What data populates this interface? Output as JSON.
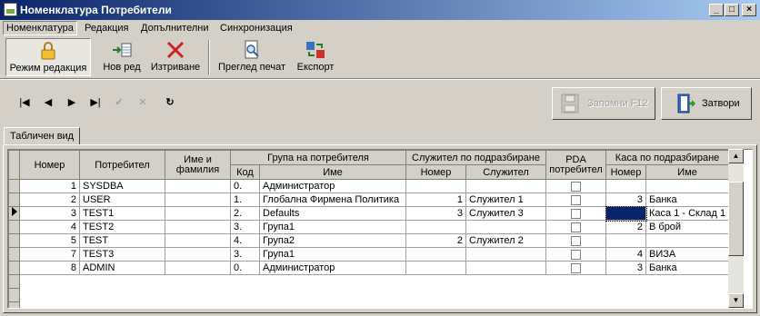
{
  "window": {
    "title": "Номенклатура Потребители"
  },
  "menu": [
    "Номенклатура",
    "Редакция",
    "Допълнителни",
    "Синхронизация"
  ],
  "toolbar": {
    "edit_mode": "Режим редакция",
    "new_row": "Нов ред",
    "delete": "Изтриване",
    "print_preview": "Преглед печат",
    "export": "Експорт"
  },
  "nav": {
    "first": "|◀",
    "prev": "◀",
    "next": "▶",
    "last": "▶|",
    "post": "✔",
    "cancel": "✕",
    "refresh": "↻",
    "save_label": "Запомни  F12",
    "close_label": "Затвори"
  },
  "tab": "Табличен вид",
  "grid": {
    "headers": {
      "number": "Номер",
      "user": "Потребител",
      "fullname": "Име и фамилия",
      "group": "Група на потребителя",
      "group_code": "Код",
      "group_name": "Име",
      "employee": "Служител по подразбиране",
      "emp_number": "Номер",
      "emp_name": "Служител",
      "pda": "PDA потребител",
      "cash": "Каса по подразбиране",
      "cash_number": "Номер",
      "cash_name": "Име"
    },
    "rows": [
      {
        "number": "1",
        "user": "SYSDBA",
        "fullname": "",
        "group_code": "0.",
        "group_name": "Администратор",
        "emp_number": "",
        "emp_name": "",
        "pda": false,
        "cash_number": "",
        "cash_name": ""
      },
      {
        "number": "2",
        "user": "USER",
        "fullname": "",
        "group_code": "1.",
        "group_name": "Глобална Фирмена Политика",
        "emp_number": "1",
        "emp_name": "Служител 1",
        "pda": false,
        "cash_number": "3",
        "cash_name": "Банка"
      },
      {
        "number": "3",
        "user": "TEST1",
        "fullname": "",
        "group_code": "2.",
        "group_name": "Defaults",
        "emp_number": "3",
        "emp_name": "Служител 3",
        "pda": false,
        "cash_number": "",
        "cash_name": "Каса 1 - Склад 1"
      },
      {
        "number": "4",
        "user": "TEST2",
        "fullname": "",
        "group_code": "3.",
        "group_name": "Група1",
        "emp_number": "",
        "emp_name": "",
        "pda": false,
        "cash_number": "2",
        "cash_name": "В брой"
      },
      {
        "number": "5",
        "user": "TEST",
        "fullname": "",
        "group_code": "4.",
        "group_name": "Група2",
        "emp_number": "2",
        "emp_name": "Служител 2",
        "pda": false,
        "cash_number": "",
        "cash_name": ""
      },
      {
        "number": "7",
        "user": "TEST3",
        "fullname": "",
        "group_code": "3.",
        "group_name": "Група1",
        "emp_number": "",
        "emp_name": "",
        "pda": false,
        "cash_number": "4",
        "cash_name": "ВИЗА"
      },
      {
        "number": "8",
        "user": "ADMIN",
        "fullname": "",
        "group_code": "0.",
        "group_name": "Администратор",
        "emp_number": "",
        "emp_name": "",
        "pda": false,
        "cash_number": "3",
        "cash_name": "Банка"
      }
    ],
    "current_row": 2
  }
}
